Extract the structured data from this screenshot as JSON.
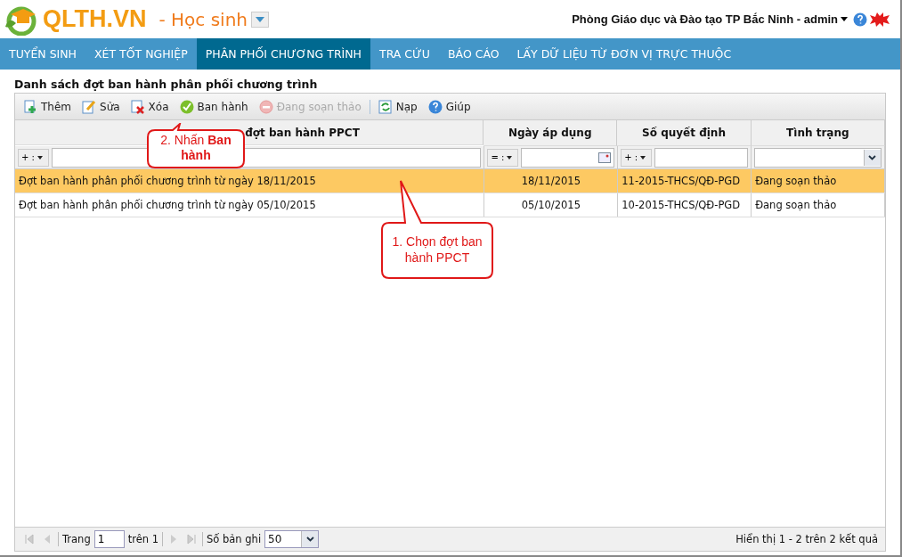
{
  "header": {
    "logo": "QLTH.VN",
    "module": "- Học sinh",
    "user": "Phòng Giáo dục và Đào tạo TP Bắc Ninh - admin"
  },
  "nav": [
    {
      "label": "TUYỂN SINH",
      "selected": false
    },
    {
      "label": "XÉT TỐT NGHIỆP",
      "selected": false
    },
    {
      "label": "PHÂN PHỐI CHƯƠNG TRÌNH",
      "selected": true
    },
    {
      "label": "TRA CỨU",
      "selected": false
    },
    {
      "label": "BÁO CÁO",
      "selected": false
    },
    {
      "label": "LẤY DỮ LIỆU TỪ ĐƠN VỊ TRỰC THUỘC",
      "selected": false
    }
  ],
  "title": "Danh sách đợt ban hành phân phối chương trình",
  "toolbar": [
    {
      "kind": "add",
      "label": "Thêm",
      "disabled": false
    },
    {
      "kind": "edit",
      "label": "Sửa",
      "disabled": false
    },
    {
      "kind": "delete",
      "label": "Xóa",
      "disabled": false
    },
    {
      "kind": "approve",
      "label": "Ban hành",
      "disabled": false
    },
    {
      "kind": "stop",
      "label": "Đang soạn thảo",
      "disabled": true
    },
    {
      "kind": "refresh",
      "label": "Nạp",
      "disabled": false
    },
    {
      "kind": "help",
      "label": "Giúp",
      "disabled": false
    }
  ],
  "columns": [
    {
      "label": "đợt ban hành PPCT",
      "kind": "op",
      "op": "+ :"
    },
    {
      "label": "Ngày áp dụng",
      "kind": "date",
      "op": "= :"
    },
    {
      "label": "Số quyết định",
      "kind": "op",
      "op": "+ :"
    },
    {
      "label": "Tình trạng",
      "kind": "select"
    }
  ],
  "rows": [
    {
      "selected": true,
      "cells": [
        "Đợt ban hành phân phối chương trình từ ngày 18/11/2015",
        "18/11/2015",
        "11-2015-THCS/QĐ-PGD",
        "Đang soạn thảo"
      ]
    },
    {
      "selected": false,
      "cells": [
        "Đợt ban hành phân phối chương trình từ ngày 05/10/2015",
        "05/10/2015",
        "10-2015-THCS/QĐ-PGD",
        "Đang soạn thảo"
      ]
    }
  ],
  "pager": {
    "page_label": "Trang",
    "page": "1",
    "of": "trên 1",
    "size_label": "Số bản ghi",
    "size": "50",
    "summary": "Hiển thị 1 - 2 trên 2 kết quả"
  },
  "callouts": [
    {
      "kind": "up",
      "text": "2. Nhấn **Ban hành**"
    },
    {
      "kind": "up-long",
      "text": "1. Chọn đợt ban hành PPCT"
    }
  ]
}
